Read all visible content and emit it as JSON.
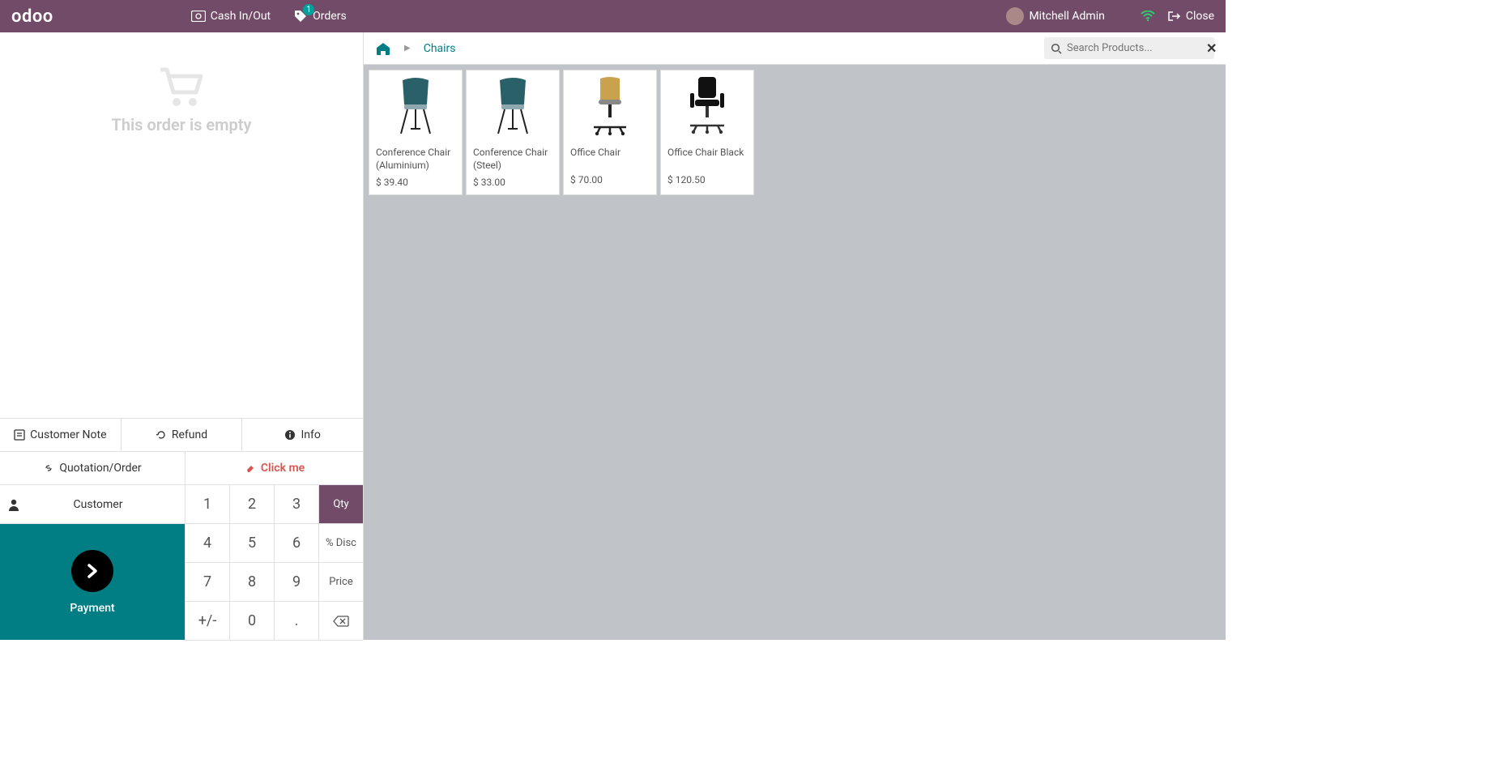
{
  "brand": "odoo",
  "topbar": {
    "cash": "Cash In/Out",
    "orders": "Orders",
    "orders_badge": "1",
    "user": "Mitchell Admin",
    "close": "Close"
  },
  "order": {
    "empty_text": "This order is empty"
  },
  "actions": {
    "customer_note": "Customer Note",
    "refund": "Refund",
    "info": "Info",
    "quotation": "Quotation/Order",
    "click_me": "Click me"
  },
  "customer_btn": "Customer",
  "payment_btn": "Payment",
  "numpad": {
    "k1": "1",
    "k2": "2",
    "k3": "3",
    "mode_qty": "Qty",
    "k4": "4",
    "k5": "5",
    "k6": "6",
    "mode_disc": "% Disc",
    "k7": "7",
    "k8": "8",
    "k9": "9",
    "mode_price": "Price",
    "sign": "+/-",
    "k0": "0",
    "dot": "."
  },
  "breadcrumb": {
    "category": "Chairs"
  },
  "search": {
    "placeholder": "Search Products..."
  },
  "products": [
    {
      "name": "Conference Chair (Aluminium)",
      "price": "$ 39.40",
      "kind": "conference-blue"
    },
    {
      "name": "Conference Chair (Steel)",
      "price": "$ 33.00",
      "kind": "conference-blue"
    },
    {
      "name": "Office Chair",
      "price": "$ 70.00",
      "kind": "office-tan"
    },
    {
      "name": "Office Chair Black",
      "price": "$ 120.50",
      "kind": "office-black"
    }
  ]
}
